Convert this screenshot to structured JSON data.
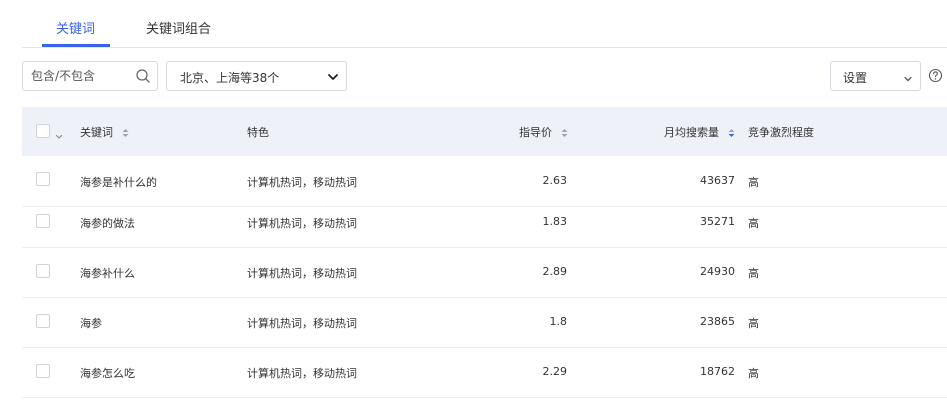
{
  "tabs": [
    {
      "label": "关键词",
      "active": true
    },
    {
      "label": "关键词组合",
      "active": false
    }
  ],
  "search": {
    "placeholder": "包含/不包含"
  },
  "region": {
    "value": "北京、上海等38个"
  },
  "settings": {
    "label": "设置"
  },
  "table": {
    "columns": {
      "keyword": "关键词",
      "feature": "特色",
      "price": "指导价",
      "monthly_search": "月均搜索量",
      "competition": "竞争激烈程度"
    },
    "rows": [
      {
        "keyword": "海参是补什么的",
        "feature": "计算机热词，移动热词",
        "price": "2.63",
        "monthly_search": "43637",
        "competition": "高"
      },
      {
        "keyword": "海参的做法",
        "feature": "计算机热词，移动热词",
        "price": "1.83",
        "monthly_search": "35271",
        "competition": "高"
      },
      {
        "keyword": "海参补什么",
        "feature": "计算机热词，移动热词",
        "price": "2.89",
        "monthly_search": "24930",
        "competition": "高"
      },
      {
        "keyword": "海参",
        "feature": "计算机热词，移动热词",
        "price": "1.8",
        "monthly_search": "23865",
        "competition": "高"
      },
      {
        "keyword": "海参怎么吃",
        "feature": "计算机热词，移动热词",
        "price": "2.29",
        "monthly_search": "18762",
        "competition": "高"
      }
    ]
  },
  "colors": {
    "accent": "#3a62e8",
    "header_bg": "#eef1f8",
    "border": "#d6d9e0"
  },
  "icons": [
    "search-icon",
    "chevron-down-icon",
    "help-icon",
    "sort-icon"
  ]
}
